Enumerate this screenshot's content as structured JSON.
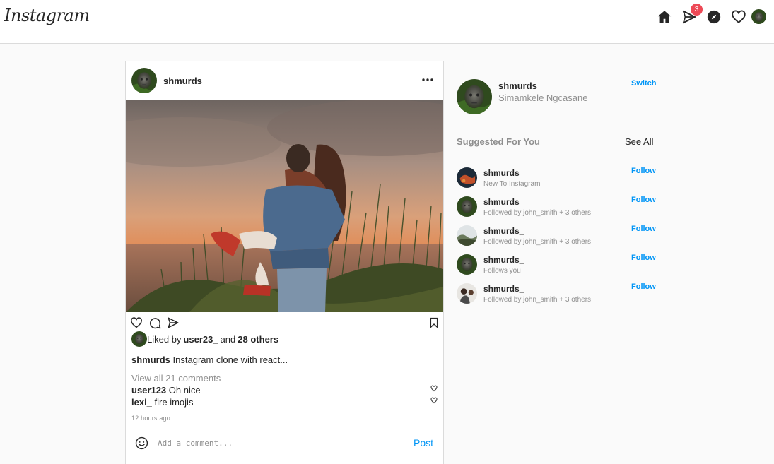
{
  "header": {
    "logo": "Instagram",
    "messages_badge": "3",
    "icons": [
      "home-icon",
      "direct-message-icon",
      "explore-icon",
      "heart-icon",
      "profile-avatar"
    ]
  },
  "post": {
    "username": "shmurds",
    "liked_by_prefix": "Liked by",
    "liked_by_user": "user23_",
    "liked_by_and": "and",
    "liked_by_others": "28 others",
    "caption_user": "shmurds",
    "caption_text": "Instagram clone with react...",
    "view_comments": "View all 21 comments",
    "comments": [
      {
        "user": "user123",
        "text": "Oh nice"
      },
      {
        "user": "lexi_",
        "text": "fire imojis"
      }
    ],
    "timestamp": "12 hours ago",
    "comment_placeholder": "Add a comment...",
    "post_button": "Post"
  },
  "sidebar": {
    "username": "shmurds_",
    "full_name": "Simamkele Ngcasane",
    "switch": "Switch",
    "suggested_title": "Suggested For You",
    "see_all": "See All",
    "follow_label": "Follow",
    "suggestions": [
      {
        "username": "shmurds_",
        "subtitle": "New To Instagram"
      },
      {
        "username": "shmurds_",
        "subtitle": "Followed by john_smith + 3 others"
      },
      {
        "username": "shmurds_",
        "subtitle": "Followed by john_smith + 3 others"
      },
      {
        "username": "shmurds_",
        "subtitle": "Follows you"
      },
      {
        "username": "shmurds_",
        "subtitle": "Followed by john_smith + 3 others"
      }
    ]
  },
  "colors": {
    "accent": "#0095f6",
    "badge": "#ed4956",
    "muted": "#8e8e8e",
    "border": "#dbdbdb"
  }
}
